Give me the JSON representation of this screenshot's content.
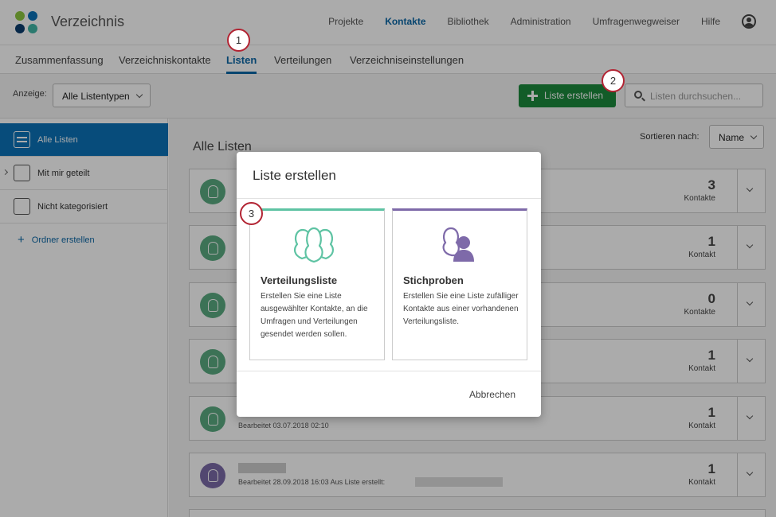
{
  "header": {
    "brand": "Verzeichnis",
    "nav": [
      "Projekte",
      "Kontakte",
      "Bibliothek",
      "Administration",
      "Umfragenwegweiser",
      "Hilfe"
    ],
    "active_nav": "Kontakte"
  },
  "subtabs": [
    {
      "label": "Zusammenfassung"
    },
    {
      "label": "Verzeichniskontakte"
    },
    {
      "label": "Listen",
      "active": true
    },
    {
      "label": "Verteilungen"
    },
    {
      "label": "Verzeichniseinstellungen"
    }
  ],
  "toolbar": {
    "anzeige_label": "Anzeige:",
    "list_type": "Alle Listentypen",
    "create_label": "Liste erstellen",
    "search_placeholder": "Listen durchsuchen..."
  },
  "sidebar": {
    "items": [
      {
        "label": "Alle Listen"
      },
      {
        "label": "Mit mir geteilt"
      },
      {
        "label": "Nicht kategorisiert"
      }
    ],
    "new_folder": "Ordner erstellen"
  },
  "main": {
    "title": "Alle Listen",
    "sort_label": "Sortieren nach:",
    "sort_value": "Name",
    "cards": [
      {
        "count": "3",
        "unit": "Kontakte",
        "meta": ""
      },
      {
        "count": "1",
        "unit": "Kontakt",
        "meta": ""
      },
      {
        "count": "0",
        "unit": "Kontakte",
        "meta": ""
      },
      {
        "count": "1",
        "unit": "Kontakt",
        "meta": ""
      },
      {
        "count": "1",
        "unit": "Kontakt",
        "meta": "Bearbeitet 03.07.2018 02:10"
      },
      {
        "count": "1",
        "unit": "Kontakt",
        "meta": "Bearbeitet 28.09.2018 16:03 Aus Liste erstellt:"
      }
    ]
  },
  "modal": {
    "title": "Liste erstellen",
    "options": [
      {
        "title": "Verteilungsliste",
        "desc": "Erstellen Sie eine Liste ausgewählter Kontakte, an die Umfragen und Verteilungen gesendet werden sollen.",
        "color": "#5ec3a3"
      },
      {
        "title": "Stichproben",
        "desc": "Erstellen Sie eine Liste zufälliger Kontakte aus einer vorhandenen Verteilungsliste.",
        "color": "#7e6aa9"
      }
    ],
    "cancel": "Abbrechen"
  },
  "badges": [
    "1",
    "2",
    "3"
  ],
  "colors": {
    "accent": "#0b67a6",
    "create_green": "#1b8a3c",
    "badge_ring": "#b22433"
  }
}
